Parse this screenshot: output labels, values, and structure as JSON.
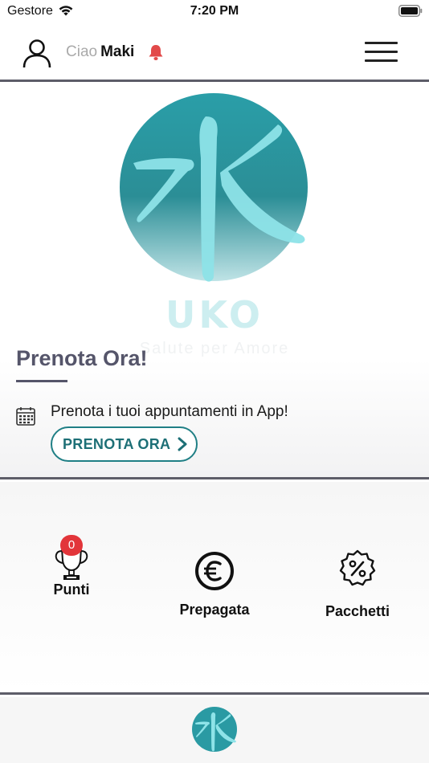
{
  "status_bar": {
    "carrier": "Gestore",
    "time": "7:20 PM"
  },
  "header": {
    "greeting": "Ciao",
    "user_name": "Maki",
    "icons": [
      "user-icon",
      "bell-icon",
      "menu-icon"
    ]
  },
  "hero": {
    "logo_text": "UKO",
    "logo_subtitle": "Salute per Amore",
    "title": "Prenota Ora!",
    "description": "Prenota i tuoi appuntamenti in App!",
    "button_label": "PRENOTA ORA"
  },
  "features": {
    "items": [
      {
        "label": "Punti",
        "icon": "trophy-icon",
        "badge": "0"
      },
      {
        "label": "Prepagata",
        "icon": "euro-icon"
      },
      {
        "label": "Pacchetti",
        "icon": "percent-badge-icon"
      }
    ]
  },
  "colors": {
    "accent_teal": "#1f7f85",
    "logo_teal": "#2aa8b0",
    "title_gray": "#55556a",
    "badge_red": "#e2353a",
    "bell_red": "#e24a4a",
    "divider": "#5d5d68"
  }
}
